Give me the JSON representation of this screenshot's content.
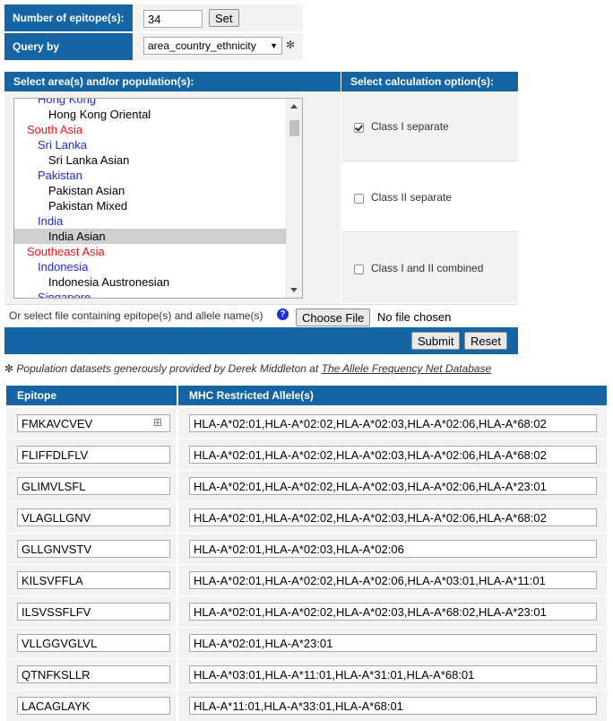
{
  "query_form": {
    "num_epitopes_label": "Number of epitope(s):",
    "num_epitopes_value": "34",
    "set_button": "Set",
    "query_by_label": "Query by",
    "query_by_value": "area_country_ethnicity",
    "query_by_note": "✻"
  },
  "selection": {
    "header": "Select area(s) and/or population(s):",
    "options": [
      {
        "label": "Hong Kong",
        "level": "country"
      },
      {
        "label": "Hong Kong Oriental",
        "level": "pop"
      },
      {
        "label": "South Asia",
        "level": "region"
      },
      {
        "label": "Sri Lanka",
        "level": "country"
      },
      {
        "label": "Sri Lanka Asian",
        "level": "pop"
      },
      {
        "label": "Pakistan",
        "level": "country"
      },
      {
        "label": "Pakistan Asian",
        "level": "pop"
      },
      {
        "label": "Pakistan Mixed",
        "level": "pop"
      },
      {
        "label": "India",
        "level": "country"
      },
      {
        "label": "India Asian",
        "level": "pop",
        "selected": true
      },
      {
        "label": "Southeast Asia",
        "level": "region"
      },
      {
        "label": "Indonesia",
        "level": "country"
      },
      {
        "label": "Indonesia Austronesian",
        "level": "pop"
      },
      {
        "label": "Singapore",
        "level": "country"
      }
    ]
  },
  "calculation": {
    "header": "Select calculation option(s):",
    "options": [
      {
        "label": "Class I separate",
        "checked": true
      },
      {
        "label": "Class II separate",
        "checked": false
      },
      {
        "label": "Class I and II combined",
        "checked": false
      }
    ]
  },
  "file_upload": {
    "label": "Or select file containing epitope(s) and allele name(s)",
    "help_icon": "?",
    "choose_button": "Choose File",
    "status": "No file chosen"
  },
  "actions": {
    "submit": "Submit",
    "reset": "Reset"
  },
  "credit": {
    "prefix": "✻ Population datasets generously provided by Derek Middleton at ",
    "link": "The Allele Frequency Net Database"
  },
  "table": {
    "col_epitope": "Epitope",
    "col_mhc": "MHC Restricted Allele(s)",
    "rows": [
      {
        "epitope": "FMKAVCVEV",
        "alleles": "HLA-A*02:01,HLA-A*02:02,HLA-A*02:03,HLA-A*02:06,HLA-A*68:02"
      },
      {
        "epitope": "FLIFFDLFLV",
        "alleles": "HLA-A*02:01,HLA-A*02:02,HLA-A*02:03,HLA-A*02:06,HLA-A*68:02"
      },
      {
        "epitope": "GLIMVLSFL",
        "alleles": "HLA-A*02:01,HLA-A*02:02,HLA-A*02:03,HLA-A*02:06,HLA-A*23:01"
      },
      {
        "epitope": "VLAGLLGNV",
        "alleles": "HLA-A*02:01,HLA-A*02:02,HLA-A*02:03,HLA-A*02:06,HLA-A*68:02"
      },
      {
        "epitope": "GLLGNVSTV",
        "alleles": "HLA-A*02:01,HLA-A*02:03,HLA-A*02:06"
      },
      {
        "epitope": "KILSVFFLA",
        "alleles": "HLA-A*02:01,HLA-A*02:02,HLA-A*02:06,HLA-A*03:01,HLA-A*11:01"
      },
      {
        "epitope": "ILSVSSFLFV",
        "alleles": "HLA-A*02:01,HLA-A*02:02,HLA-A*02:03,HLA-A*68:02,HLA-A*23:01"
      },
      {
        "epitope": "VLLGGVGLVL",
        "alleles": "HLA-A*02:01,HLA-A*23:01"
      },
      {
        "epitope": "QTNFKSLLR",
        "alleles": "HLA-A*03:01,HLA-A*11:01,HLA-A*31:01,HLA-A*68:01"
      },
      {
        "epitope": "LACAGLAYK",
        "alleles": "HLA-A*11:01,HLA-A*33:01,HLA-A*68:01"
      }
    ]
  },
  "colors": {
    "header_blue": "#1565a4",
    "region_red": "#e8171d",
    "country_blue": "#1f2be0",
    "panel_gray": "#f2f2f2"
  }
}
